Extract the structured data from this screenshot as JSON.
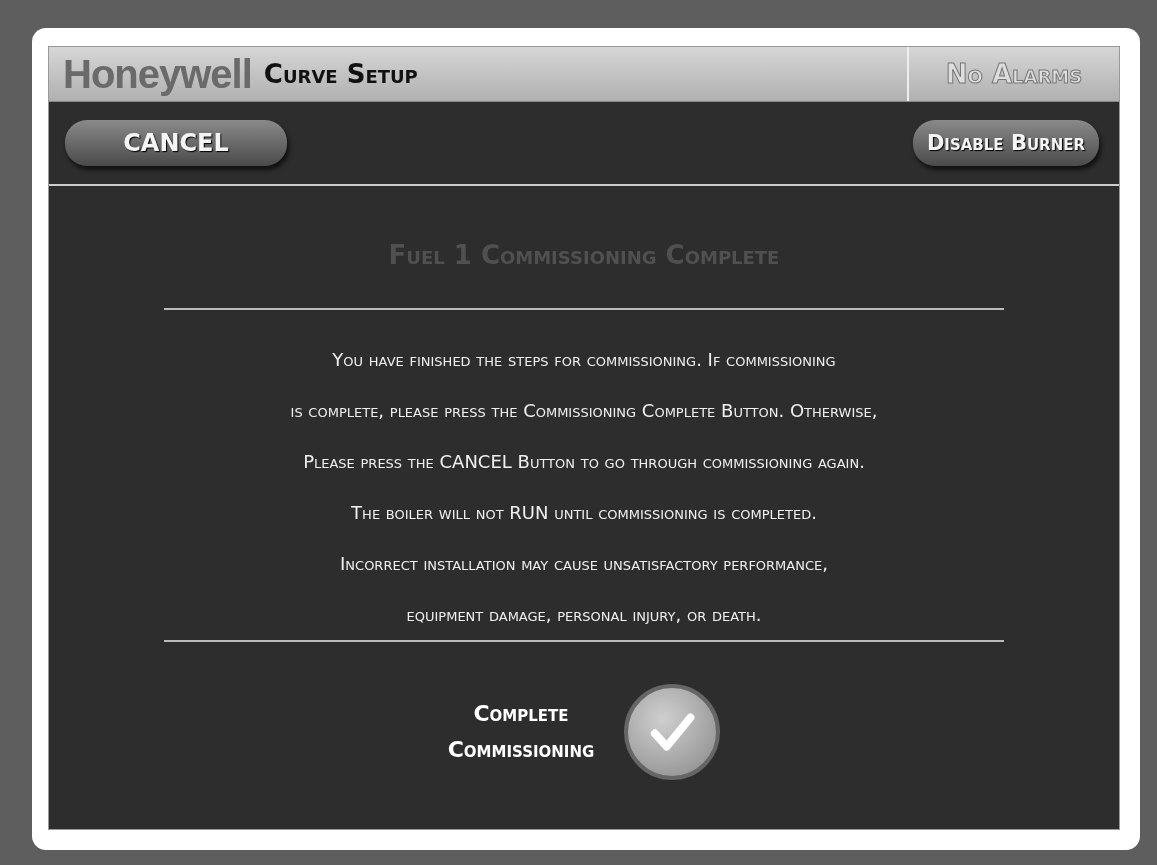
{
  "header": {
    "brand": "Honeywell",
    "title": "Curve Setup",
    "alarm_status": "No Alarms"
  },
  "toolbar": {
    "cancel_button": "CANCEL",
    "disable_button": "Disable Burner"
  },
  "dialog": {
    "title": "Fuel 1 Commissioning Complete",
    "title_disabled": true,
    "message_lines": [
      "You have finished the steps for commissioning. If commissioning",
      "is complete, please press the Commissioning Complete Button. Otherwise,",
      "Please press the CANCEL Button to go through commissioning again.",
      "The boiler will not RUN until commissioning is completed.",
      "Incorrect installation may cause unsatisfactory performance,",
      "equipment damage, personal injury, or death."
    ],
    "complete_label": [
      "Complete",
      "Commissioning"
    ]
  }
}
